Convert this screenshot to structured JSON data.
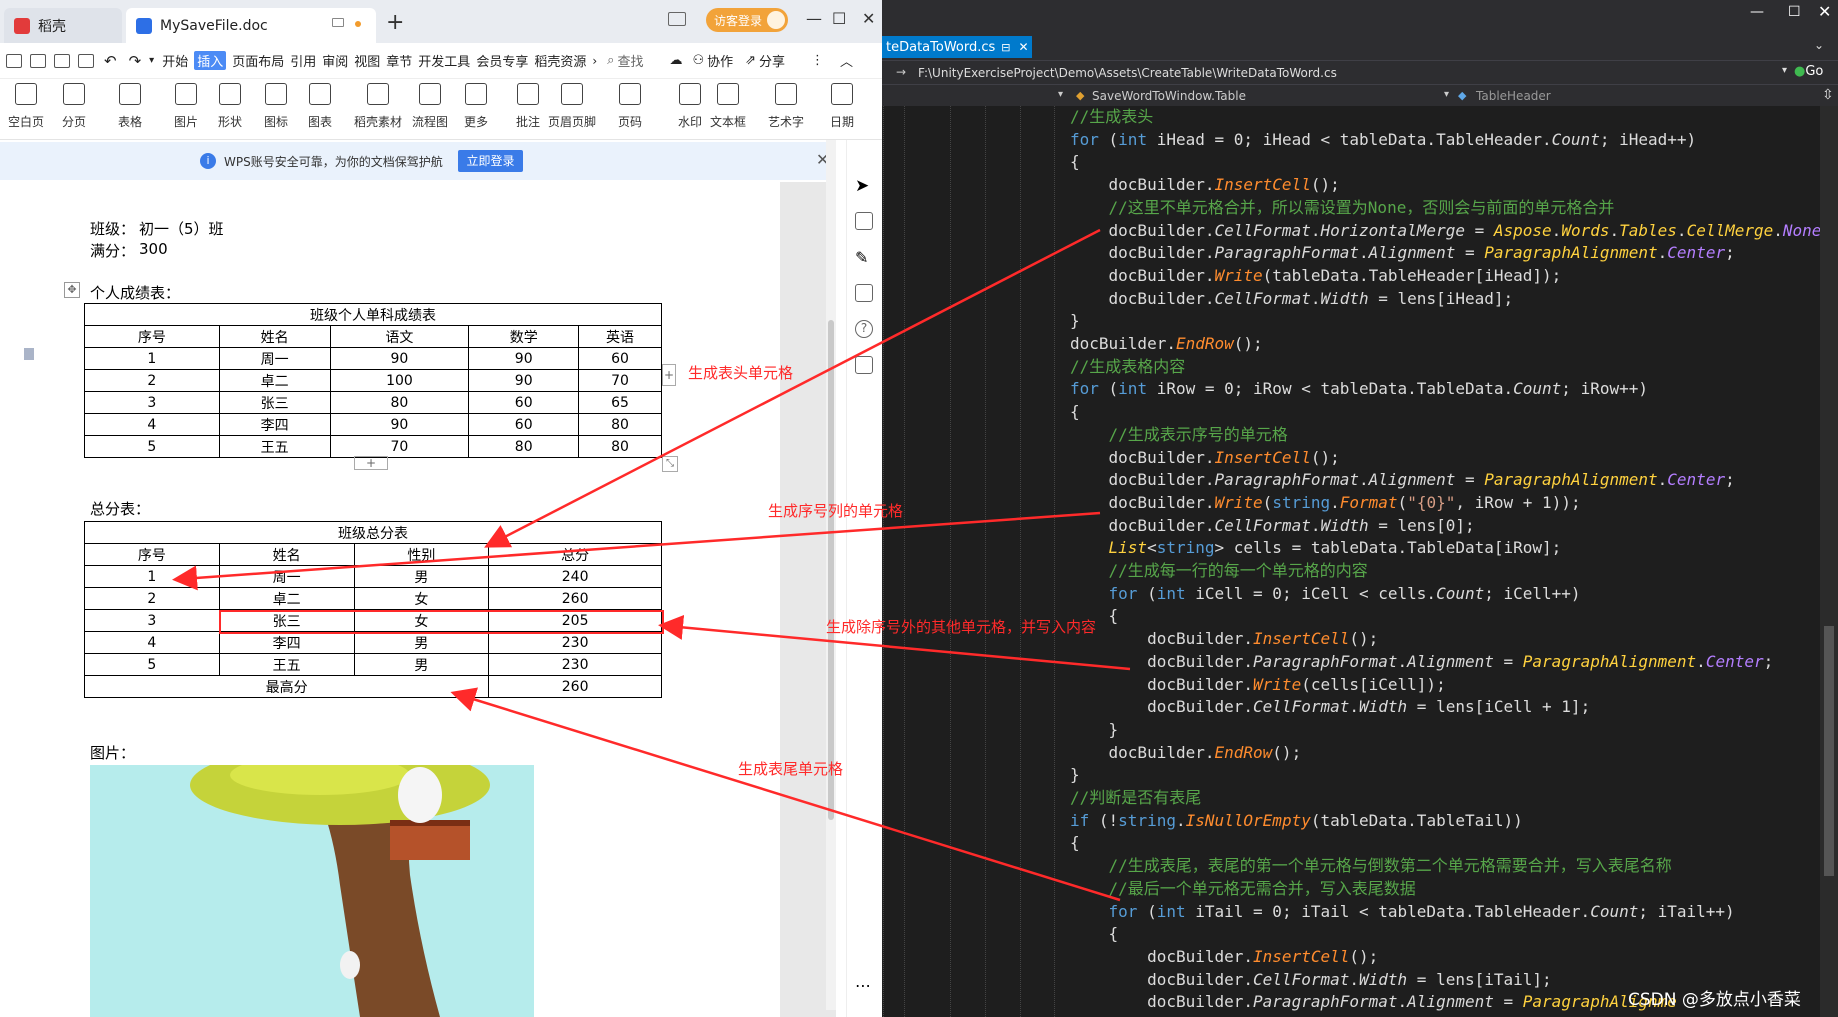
{
  "wps": {
    "tabs": [
      {
        "label": "稻壳"
      },
      {
        "label": "MySaveFile.doc"
      }
    ],
    "guest_login": "访客登录",
    "menu": [
      "开始",
      "插入",
      "页面布局",
      "引用",
      "审阅",
      "视图",
      "章节",
      "开发工具",
      "会员专享",
      "稻壳资源"
    ],
    "menu_active": "插入",
    "search_label": "查找",
    "collab_label": "协作",
    "share_label": "分享",
    "ribbon": [
      "空白页",
      "分页",
      "表格",
      "图片",
      "形状",
      "图标",
      "图表",
      "稻壳素材",
      "流程图",
      "更多",
      "批注",
      "页眉页脚",
      "页码",
      "水印",
      "文本框",
      "艺术字",
      "日期"
    ],
    "notice": {
      "text": "WPS账号安全可靠，为你的文档保驾护航",
      "button": "立即登录"
    },
    "doc": {
      "class_label": "班级：",
      "class_value": "初一（5）班",
      "full_label": "满分：",
      "full_value": "300",
      "section1": "个人成绩表：",
      "table1": {
        "title": "班级个人单科成绩表",
        "headers": [
          "序号",
          "姓名",
          "语文",
          "数学",
          "英语"
        ],
        "rows": [
          [
            "1",
            "周一",
            "90",
            "90",
            "60"
          ],
          [
            "2",
            "卓二",
            "100",
            "90",
            "70"
          ],
          [
            "3",
            "张三",
            "80",
            "60",
            "65"
          ],
          [
            "4",
            "李四",
            "90",
            "60",
            "80"
          ],
          [
            "5",
            "王五",
            "70",
            "80",
            "80"
          ]
        ]
      },
      "section2": "总分表：",
      "table2": {
        "title": "班级总分表",
        "headers": [
          "序号",
          "姓名",
          "性别",
          "总分"
        ],
        "rows": [
          [
            "1",
            "周一",
            "男",
            "240"
          ],
          [
            "2",
            "卓二",
            "女",
            "260"
          ],
          [
            "3",
            "张三",
            "女",
            "205"
          ],
          [
            "4",
            "李四",
            "男",
            "230"
          ],
          [
            "5",
            "王五",
            "男",
            "230"
          ]
        ],
        "tail_label": "最高分",
        "tail_value": "260"
      },
      "section3": "图片："
    }
  },
  "vs": {
    "tab_label": "teDataToWord.cs",
    "path": "F:\\UnityExerciseProject\\Demo\\Assets\\CreateTable\\WriteDataToWord.cs",
    "nav_left": "SaveWordToWindow.Table",
    "nav_right": "TableHeader",
    "go_label": "Go",
    "code": [
      [
        [
          "c-cm",
          "//生成表头"
        ]
      ],
      [
        [
          "c-kw",
          "for"
        ],
        [
          "c-tx",
          " ("
        ],
        [
          "c-kw",
          "int"
        ],
        [
          "c-tx",
          " iHead = 0; iHead < tableData.TableHeader."
        ],
        [
          "c-pr",
          "Count"
        ],
        [
          "c-tx",
          "; iHead++)"
        ]
      ],
      [
        [
          "c-tx",
          "{"
        ]
      ],
      [
        [
          "c-tx",
          "    docBuilder."
        ],
        [
          "c-mt",
          "InsertCell"
        ],
        [
          "c-tx",
          "();"
        ]
      ],
      [
        [
          "c-cm",
          "    //这里不单元格合并，所以需设置为None，否则会与前面的单元格合并"
        ]
      ],
      [
        [
          "c-tx",
          "    docBuilder."
        ],
        [
          "c-pr",
          "CellFormat"
        ],
        [
          "c-tx",
          "."
        ],
        [
          "c-pr",
          "HorizontalMerge"
        ],
        [
          "c-tx",
          " = "
        ],
        [
          "c-ty",
          "Aspose"
        ],
        [
          "c-tx",
          "."
        ],
        [
          "c-ty",
          "Words"
        ],
        [
          "c-tx",
          "."
        ],
        [
          "c-ty",
          "Tables"
        ],
        [
          "c-tx",
          "."
        ],
        [
          "c-ty",
          "CellMerge"
        ],
        [
          "c-tx",
          "."
        ],
        [
          "c-en",
          "None"
        ],
        [
          "c-tx",
          ";"
        ]
      ],
      [
        [
          "c-tx",
          "    docBuilder."
        ],
        [
          "c-pr",
          "ParagraphFormat"
        ],
        [
          "c-tx",
          "."
        ],
        [
          "c-pr",
          "Alignment"
        ],
        [
          "c-tx",
          " = "
        ],
        [
          "c-ty",
          "ParagraphAlignment"
        ],
        [
          "c-tx",
          "."
        ],
        [
          "c-en",
          "Center"
        ],
        [
          "c-tx",
          ";"
        ]
      ],
      [
        [
          "c-tx",
          "    docBuilder."
        ],
        [
          "c-mt",
          "Write"
        ],
        [
          "c-tx",
          "(tableData.TableHeader[iHead]);"
        ]
      ],
      [
        [
          "c-tx",
          "    docBuilder."
        ],
        [
          "c-pr",
          "CellFormat"
        ],
        [
          "c-tx",
          "."
        ],
        [
          "c-pr",
          "Width"
        ],
        [
          "c-tx",
          " = lens[iHead];"
        ]
      ],
      [
        [
          "c-tx",
          "}"
        ]
      ],
      [
        [
          "c-tx",
          "docBuilder."
        ],
        [
          "c-mt",
          "EndRow"
        ],
        [
          "c-tx",
          "();"
        ]
      ],
      [
        [
          "c-cm",
          "//生成表格内容"
        ]
      ],
      [
        [
          "c-kw",
          "for"
        ],
        [
          "c-tx",
          " ("
        ],
        [
          "c-kw",
          "int"
        ],
        [
          "c-tx",
          " iRow = 0; iRow < tableData.TableData."
        ],
        [
          "c-pr",
          "Count"
        ],
        [
          "c-tx",
          "; iRow++)"
        ]
      ],
      [
        [
          "c-tx",
          "{"
        ]
      ],
      [
        [
          "c-cm",
          "    //生成表示序号的单元格"
        ]
      ],
      [
        [
          "c-tx",
          "    docBuilder."
        ],
        [
          "c-mt",
          "InsertCell"
        ],
        [
          "c-tx",
          "();"
        ]
      ],
      [
        [
          "c-tx",
          "    docBuilder."
        ],
        [
          "c-pr",
          "ParagraphFormat"
        ],
        [
          "c-tx",
          "."
        ],
        [
          "c-pr",
          "Alignment"
        ],
        [
          "c-tx",
          " = "
        ],
        [
          "c-ty",
          "ParagraphAlignment"
        ],
        [
          "c-tx",
          "."
        ],
        [
          "c-en",
          "Center"
        ],
        [
          "c-tx",
          ";"
        ]
      ],
      [
        [
          "c-tx",
          "    docBuilder."
        ],
        [
          "c-mt",
          "Write"
        ],
        [
          "c-tx",
          "("
        ],
        [
          "c-kw",
          "string"
        ],
        [
          "c-tx",
          "."
        ],
        [
          "c-mt",
          "Format"
        ],
        [
          "c-tx",
          "("
        ],
        [
          "c-st",
          "\"{0}\""
        ],
        [
          "c-tx",
          ", iRow + 1));"
        ]
      ],
      [
        [
          "c-tx",
          "    docBuilder."
        ],
        [
          "c-pr",
          "CellFormat"
        ],
        [
          "c-tx",
          "."
        ],
        [
          "c-pr",
          "Width"
        ],
        [
          "c-tx",
          " = lens[0];"
        ]
      ],
      [
        [
          "c-ty",
          "    List"
        ],
        [
          "c-tx",
          "<"
        ],
        [
          "c-kw",
          "string"
        ],
        [
          "c-tx",
          "> cells = tableData.TableData[iRow];"
        ]
      ],
      [
        [
          "c-cm",
          "    //生成每一行的每一个单元格的内容"
        ]
      ],
      [
        [
          "c-kw",
          "    for"
        ],
        [
          "c-tx",
          " ("
        ],
        [
          "c-kw",
          "int"
        ],
        [
          "c-tx",
          " iCell = 0; iCell < cells."
        ],
        [
          "c-pr",
          "Count"
        ],
        [
          "c-tx",
          "; iCell++)"
        ]
      ],
      [
        [
          "c-tx",
          "    {"
        ]
      ],
      [
        [
          "c-tx",
          "        docBuilder."
        ],
        [
          "c-mt",
          "InsertCell"
        ],
        [
          "c-tx",
          "();"
        ]
      ],
      [
        [
          "c-tx",
          "        docBuilder."
        ],
        [
          "c-pr",
          "ParagraphFormat"
        ],
        [
          "c-tx",
          "."
        ],
        [
          "c-pr",
          "Alignment"
        ],
        [
          "c-tx",
          " = "
        ],
        [
          "c-ty",
          "ParagraphAlignment"
        ],
        [
          "c-tx",
          "."
        ],
        [
          "c-en",
          "Center"
        ],
        [
          "c-tx",
          ";"
        ]
      ],
      [
        [
          "c-tx",
          "        docBuilder."
        ],
        [
          "c-mt",
          "Write"
        ],
        [
          "c-tx",
          "(cells[iCell]);"
        ]
      ],
      [
        [
          "c-tx",
          "        docBuilder."
        ],
        [
          "c-pr",
          "CellFormat"
        ],
        [
          "c-tx",
          "."
        ],
        [
          "c-pr",
          "Width"
        ],
        [
          "c-tx",
          " = lens[iCell + 1];"
        ]
      ],
      [
        [
          "c-tx",
          "    }"
        ]
      ],
      [
        [
          "c-tx",
          "    docBuilder."
        ],
        [
          "c-mt",
          "EndRow"
        ],
        [
          "c-tx",
          "();"
        ]
      ],
      [
        [
          "c-tx",
          "}"
        ]
      ],
      [
        [
          "c-cm",
          "//判断是否有表尾"
        ]
      ],
      [
        [
          "c-kw",
          "if"
        ],
        [
          "c-tx",
          " (!"
        ],
        [
          "c-kw",
          "string"
        ],
        [
          "c-tx",
          "."
        ],
        [
          "c-mt",
          "IsNullOrEmpty"
        ],
        [
          "c-tx",
          "(tableData.TableTail))"
        ]
      ],
      [
        [
          "c-tx",
          "{"
        ]
      ],
      [
        [
          "c-cm",
          "    //生成表尾，表尾的第一个单元格与倒数第二个单元格需要合并，写入表尾名称"
        ]
      ],
      [
        [
          "c-cm",
          "    //最后一个单元格无需合并，写入表尾数据"
        ]
      ],
      [
        [
          "c-kw",
          "    for"
        ],
        [
          "c-tx",
          " ("
        ],
        [
          "c-kw",
          "int"
        ],
        [
          "c-tx",
          " iTail = 0; iTail < tableData.TableHeader."
        ],
        [
          "c-pr",
          "Count"
        ],
        [
          "c-tx",
          "; iTail++)"
        ]
      ],
      [
        [
          "c-tx",
          "    {"
        ]
      ],
      [
        [
          "c-tx",
          "        docBuilder."
        ],
        [
          "c-mt",
          "InsertCell"
        ],
        [
          "c-tx",
          "();"
        ]
      ],
      [
        [
          "c-tx",
          "        docBuilder."
        ],
        [
          "c-pr",
          "CellFormat"
        ],
        [
          "c-tx",
          "."
        ],
        [
          "c-pr",
          "Width"
        ],
        [
          "c-tx",
          " = lens[iTail];"
        ]
      ],
      [
        [
          "c-tx",
          "        docBuilder."
        ],
        [
          "c-pr",
          "ParagraphFormat"
        ],
        [
          "c-tx",
          "."
        ],
        [
          "c-pr",
          "Alignment"
        ],
        [
          "c-tx",
          " = "
        ],
        [
          "c-ty",
          "ParagraphAlignme"
        ]
      ]
    ]
  },
  "annotations": {
    "header_cells": "生成表头单元格",
    "index_cells": "生成序号列的单元格",
    "other_cells": "生成除序号外的其他单元格，并写入内容",
    "tail_cells": "生成表尾单元格"
  },
  "watermark": "CSDN @多放点小香菜",
  "colors": {
    "annotation": "#ff2a2a",
    "wps_accent": "#3a7be8",
    "vs_bg": "#1e1e1e"
  }
}
